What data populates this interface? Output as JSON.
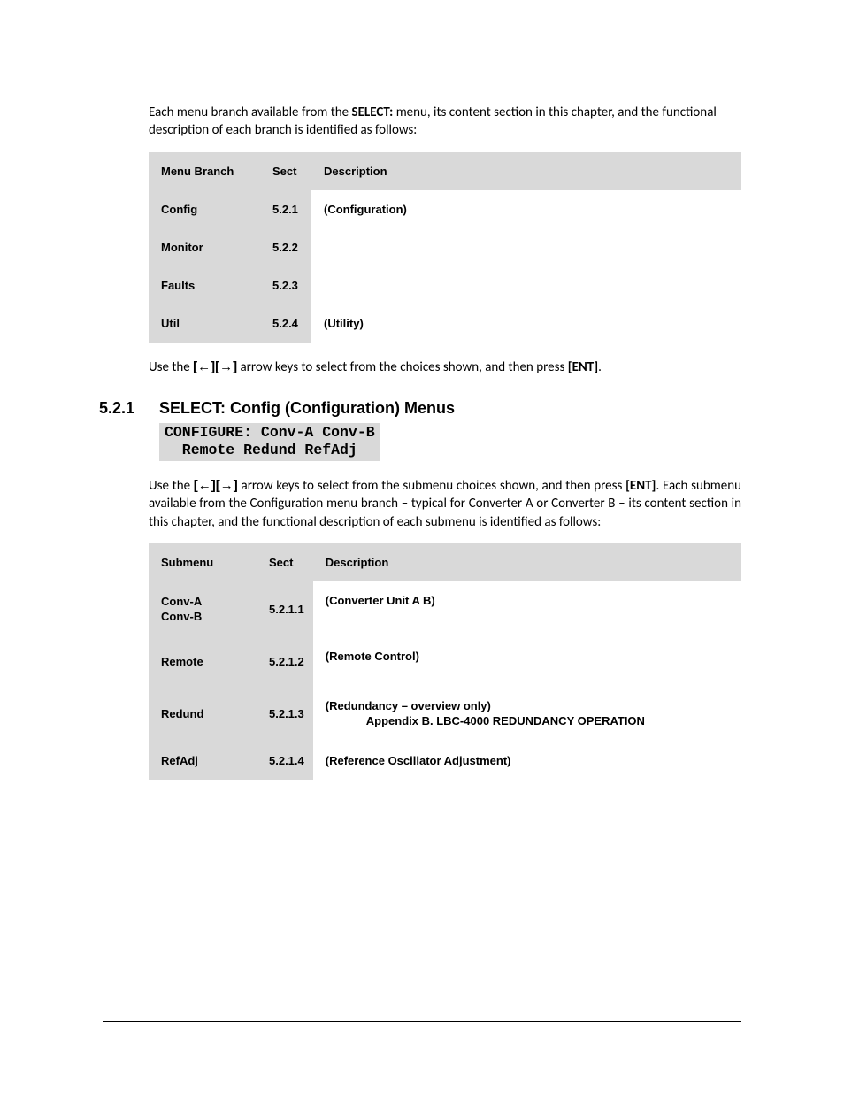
{
  "intro": {
    "p1_a": "Each menu branch available from the ",
    "p1_bold": "SELECT:",
    "p1_b": " menu, its content section in this chapter, and the functional description of each branch is identified as follows:"
  },
  "table1": {
    "headers": {
      "c1": "Menu Branch",
      "c2": "Sect",
      "c3": "Description"
    },
    "rows": [
      {
        "c1": "Config",
        "c2": "5.2.1",
        "c3": "(Configuration)"
      },
      {
        "c1": "Monitor",
        "c2": "5.2.2",
        "c3": ""
      },
      {
        "c1": "Faults",
        "c2": "5.2.3",
        "c3": ""
      },
      {
        "c1": "Util",
        "c2": "5.2.4",
        "c3": "(Utility)"
      }
    ]
  },
  "hint1": {
    "a": "Use the ",
    "keys": "[←][→]",
    "b": " arrow keys to select from the choices shown, and then press ",
    "ent": "[ENT]",
    "c": "."
  },
  "sec": {
    "num": "5.2.1",
    "title": "SELECT: Config (Configuration) Menus"
  },
  "code": "CONFIGURE: Conv-A Conv-B\n  Remote Redund RefAdj",
  "hint2": {
    "a": "Use the ",
    "keys": "[←][→]",
    "b": " arrow keys to select from the submenu choices shown, and then press ",
    "ent": "[ENT]",
    "c": ". Each submenu available from the Configuration menu branch – typical for Converter A or Converter B – its content section in this chapter, and the functional description of each submenu is identified as follows:"
  },
  "table2": {
    "headers": {
      "c1": "Submenu",
      "c2": "Sect",
      "c3": "Description"
    },
    "rows": [
      {
        "c1": "Conv-A\nConv-B",
        "c2": "5.2.1.1",
        "c3": "(Converter Unit A     B)"
      },
      {
        "c1": "Remote",
        "c2": "5.2.1.2",
        "c3": "(Remote Control)"
      },
      {
        "c1": "Redund",
        "c2": "5.2.1.3",
        "c3_line1": "(Redundancy – overview only)",
        "c3_line2": "Appendix B. LBC-4000 REDUNDANCY OPERATION"
      },
      {
        "c1": "RefAdj",
        "c2": "5.2.1.4",
        "c3": "(Reference Oscillator Adjustment)"
      }
    ]
  }
}
